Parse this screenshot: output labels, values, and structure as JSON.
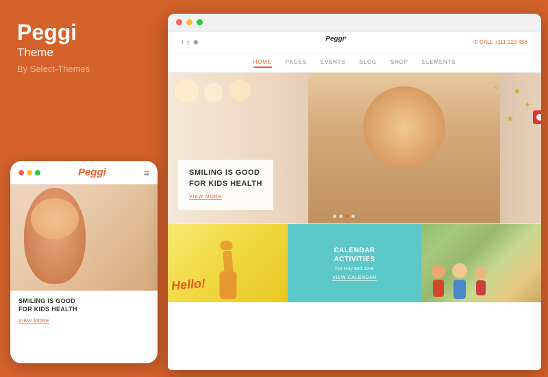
{
  "left": {
    "title": "Peggi",
    "subtitle": "Theme",
    "byline": "By Select-Themes"
  },
  "mobile": {
    "dots": [
      "red",
      "yellow",
      "green"
    ],
    "logo": "Peggi",
    "hamburger": "≡",
    "hero_gradient": "warm",
    "caption_title": "SMILING IS GOOD\nFOR KIDS HEALTH",
    "view_more": "VIEW MORE"
  },
  "browser": {
    "dots": [
      "red",
      "yellow",
      "green"
    ],
    "social_icons": [
      "f",
      "t",
      "◉"
    ],
    "call_label": "CALL",
    "call_number": "+111 223 456",
    "logo": "Peggi",
    "nav_items": [
      {
        "label": "HOME",
        "active": true
      },
      {
        "label": "PAGES",
        "active": false
      },
      {
        "label": "EVENTS",
        "active": false
      },
      {
        "label": "BLOG",
        "active": false
      },
      {
        "label": "SHOP",
        "active": false
      },
      {
        "label": "ELEMENTS",
        "active": false
      }
    ],
    "hero": {
      "title": "SMILING IS GOOD\nFOR KIDS HEALTH",
      "link_text": "VIEW MORE",
      "dots": [
        false,
        false,
        true,
        false
      ]
    },
    "cards": [
      {
        "type": "yellow",
        "hello_text": "Hello!",
        "giraffe": true
      },
      {
        "type": "teal",
        "title": "CALENDAR\nACTIVITIES",
        "subtitle": "For May and June",
        "link_text": "VIEW CALENDAR"
      },
      {
        "type": "photo",
        "alt": "kids playing outside"
      }
    ]
  },
  "colors": {
    "brand_orange": "#d4622a",
    "accent_orange": "#e8622a",
    "teal": "#5cc8c8",
    "white": "#ffffff"
  }
}
